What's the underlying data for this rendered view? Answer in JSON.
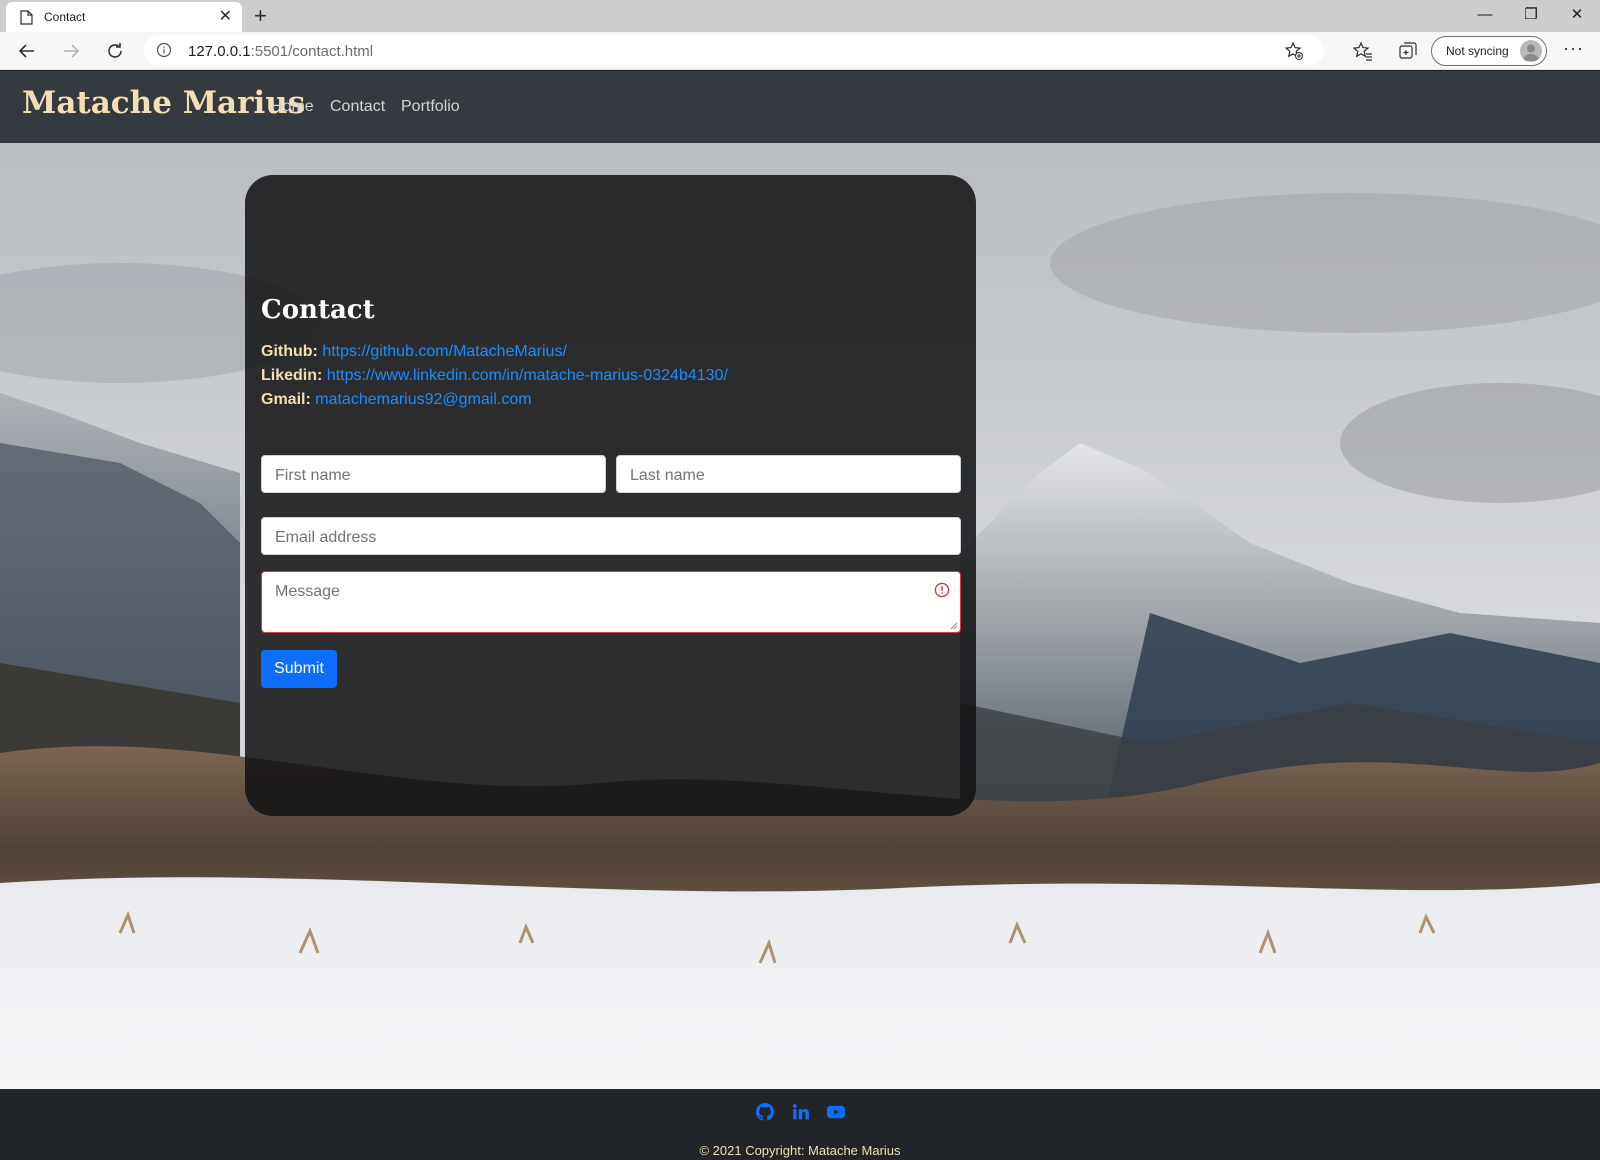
{
  "browser": {
    "tab_title": "Contact",
    "tab_close": "✕",
    "new_tab": "+",
    "window_controls": {
      "minimize": "—",
      "restore": "❐",
      "close": "✕"
    },
    "address_host": "127.0.0.1",
    "address_rest": ":5501/contact.html",
    "sync_label": "Not syncing",
    "more": "···",
    "icons": [
      "back-icon",
      "forward-icon",
      "refresh-icon",
      "info-icon",
      "add-favorite-icon",
      "favorites-icon",
      "collections-icon",
      "profile-icon",
      "more-icon"
    ]
  },
  "site_nav": {
    "brand": "Matache Marius",
    "links": [
      "Home",
      "Contact",
      "Portfolio"
    ]
  },
  "contact": {
    "title": "Contact",
    "items": [
      {
        "key": "Github:",
        "value": "https://github.com/MatacheMarius/"
      },
      {
        "key": "Likedin:",
        "value": "https://www.linkedin.com/in/matache-marius-0324b4130/"
      },
      {
        "key": "Gmail:",
        "value": "matachemarius92@gmail.com"
      }
    ],
    "form": {
      "first_name_placeholder": "First name",
      "last_name_placeholder": "Last name",
      "email_placeholder": "Email address",
      "message_placeholder": "Message",
      "submit_label": "Submit"
    }
  },
  "footer": {
    "social_icons": [
      "github-icon",
      "linkedin-icon",
      "youtube-icon"
    ],
    "copyright": "© 2021 Copyright: Matache Marius"
  },
  "colors": {
    "navbar_bg": "#343a40",
    "brand": "#f5deb3",
    "link_blue": "#1b8cff",
    "button_blue": "#0d6efd",
    "invalid_red": "#dc3545",
    "footer_bg": "#212529"
  }
}
